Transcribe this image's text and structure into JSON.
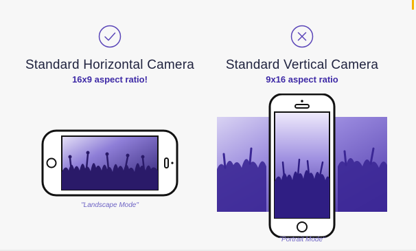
{
  "left": {
    "status_icon": "checkmark-circle-icon",
    "title": "Standard Horizontal Camera",
    "subtitle": "16x9 aspect ratio!",
    "caption": "\"Landscape Mode\""
  },
  "right": {
    "status_icon": "x-circle-icon",
    "title": "Standard Vertical Camera",
    "subtitle": "9x16 aspect ratio",
    "caption": "\"Portrait Mode\""
  },
  "colors": {
    "accent": "#4a2fb0",
    "text": "#20233f",
    "photo_tint": "#6b54c9",
    "phone_frame": "#111111"
  }
}
